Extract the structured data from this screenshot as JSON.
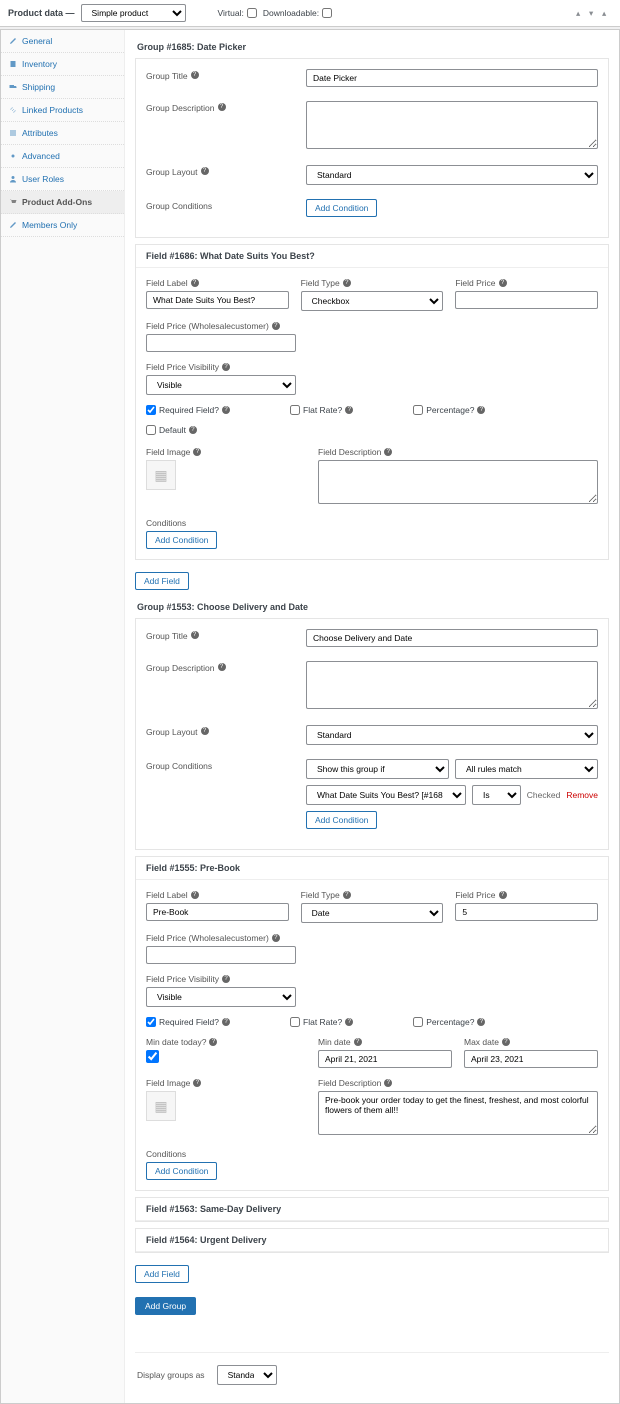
{
  "header": {
    "title": "Product data —",
    "productType": "Simple product",
    "virtualLabel": "Virtual:",
    "downloadableLabel": "Downloadable:"
  },
  "sidebar": {
    "items": [
      {
        "label": "General"
      },
      {
        "label": "Inventory"
      },
      {
        "label": "Shipping"
      },
      {
        "label": "Linked Products"
      },
      {
        "label": "Attributes"
      },
      {
        "label": "Advanced"
      },
      {
        "label": "User Roles"
      },
      {
        "label": "Product Add-Ons"
      },
      {
        "label": "Members Only"
      }
    ]
  },
  "group1": {
    "header": "Group #1685: Date Picker",
    "titleLabel": "Group Title",
    "titleValue": "Date Picker",
    "descLabel": "Group Description",
    "layoutLabel": "Group Layout",
    "layoutValue": "Standard",
    "condLabel": "Group Conditions",
    "addCond": "Add Condition"
  },
  "field1": {
    "header": "Field #1686: What Date Suits You Best?",
    "labelLbl": "Field Label",
    "labelVal": "What Date Suits You Best?",
    "typeLbl": "Field Type",
    "typeVal": "Checkbox",
    "priceLbl": "Field Price",
    "wholesaleLbl": "Field Price (Wholesalecustomer)",
    "visibLbl": "Field Price Visibility",
    "visibVal": "Visible",
    "requiredLbl": "Required Field?",
    "flatLbl": "Flat Rate?",
    "pctLbl": "Percentage?",
    "defaultLbl": "Default",
    "imgLbl": "Field Image",
    "descFieldLbl": "Field Description",
    "condLbl": "Conditions",
    "addCond": "Add Condition"
  },
  "addField": "Add Field",
  "group2": {
    "header": "Group #1553: Choose Delivery and Date",
    "titleLabel": "Group Title",
    "titleValue": "Choose Delivery and Date",
    "descLabel": "Group Description",
    "layoutLabel": "Group Layout",
    "layoutValue": "Standard",
    "condLabel": "Group Conditions",
    "condShow": "Show this group if",
    "condMatch": "All rules match",
    "condField": "What Date Suits You Best? [#168",
    "condOp": "Is",
    "checked": "Checked",
    "remove": "Remove",
    "addCond": "Add Condition"
  },
  "field2": {
    "header": "Field #1555: Pre-Book",
    "labelLbl": "Field Label",
    "labelVal": "Pre-Book",
    "typeLbl": "Field Type",
    "typeVal": "Date",
    "priceLbl": "Field Price",
    "priceVal": "5",
    "wholesaleLbl": "Field Price (Wholesalecustomer)",
    "visibLbl": "Field Price Visibility",
    "visibVal": "Visible",
    "requiredLbl": "Required Field?",
    "flatLbl": "Flat Rate?",
    "pctLbl": "Percentage?",
    "minTodayLbl": "Min date today?",
    "minDateLbl": "Min date",
    "minDateVal": "April 21, 2021",
    "maxDateLbl": "Max date",
    "maxDateVal": "April 23, 2021",
    "imgLbl": "Field Image",
    "descFieldLbl": "Field Description",
    "descVal": "Pre-book your order today to get the finest, freshest, and most colorful flowers of them all!!",
    "condLbl": "Conditions",
    "addCond": "Add Condition"
  },
  "field3": {
    "header": "Field #1563: Same-Day Delivery"
  },
  "field4": {
    "header": "Field #1564: Urgent Delivery"
  },
  "addGroup": "Add Group",
  "displayAs": "Display groups as",
  "displayVal": "Standard"
}
